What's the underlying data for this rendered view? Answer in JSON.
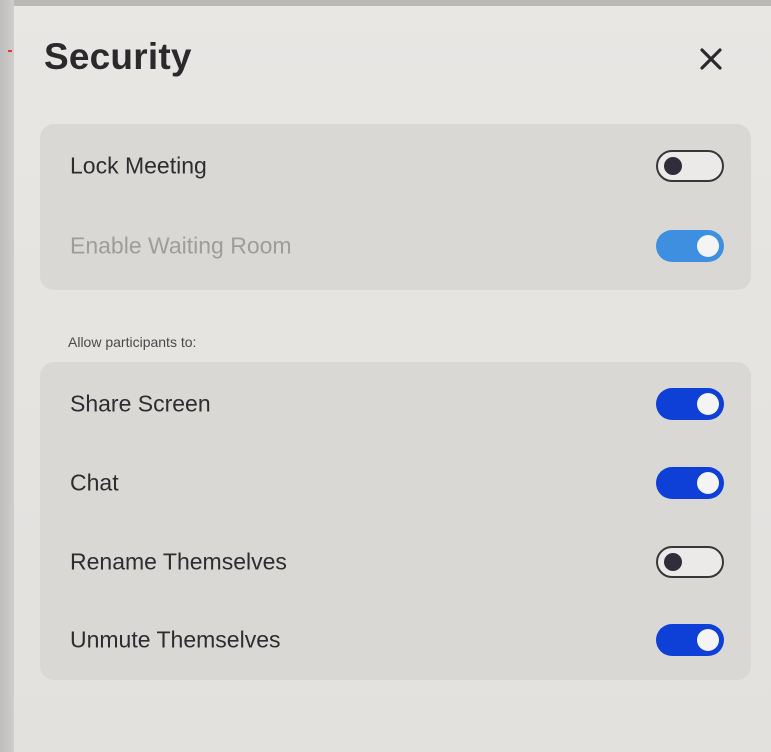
{
  "dialog": {
    "title": "Security",
    "close_icon": "close-icon"
  },
  "meeting_options": [
    {
      "label": "Lock Meeting",
      "enabled": true,
      "on": false
    },
    {
      "label": "Enable Waiting Room",
      "enabled": false,
      "on": true
    }
  ],
  "participants_section": {
    "label": "Allow participants to:"
  },
  "participant_options": [
    {
      "label": "Share Screen",
      "on": true
    },
    {
      "label": "Chat",
      "on": true
    },
    {
      "label": "Rename Themselves",
      "on": false
    },
    {
      "label": "Unmute Themselves",
      "on": true
    }
  ],
  "colors": {
    "toggle_on": "#0e3fd6",
    "toggle_on_disabled": "#3f8fe0",
    "toggle_off_border": "#37363b",
    "panel_background": "#e8e6e3"
  }
}
